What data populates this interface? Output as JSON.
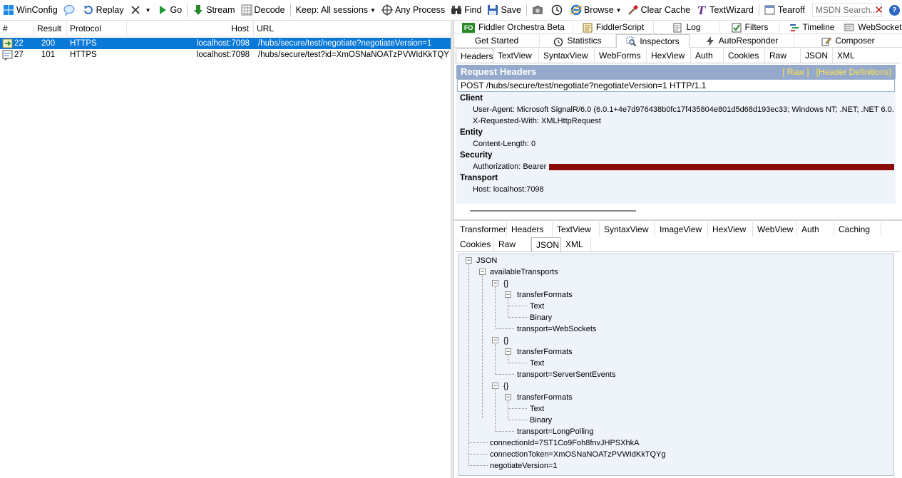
{
  "toolbar": {
    "winconfig": "WinConfig",
    "replay": "Replay",
    "go": "Go",
    "stream": "Stream",
    "decode": "Decode",
    "keep": "Keep: All sessions",
    "any_process": "Any Process",
    "find": "Find",
    "save": "Save",
    "browse": "Browse",
    "clear_cache": "Clear Cache",
    "textwizard": "TextWizard",
    "tearoff": "Tearoff",
    "msdn_placeholder": "MSDN Search...",
    "help": "?",
    "close": "✕"
  },
  "sessions": {
    "columns": [
      "#",
      "Result",
      "Protocol",
      "Host",
      "URL"
    ],
    "rows": [
      {
        "id": "22",
        "result": "200",
        "protocol": "HTTPS",
        "host": "localhost:7098",
        "url": "/hubs/secure/test/negotiate?negotiateVersion=1"
      },
      {
        "id": "27",
        "result": "101",
        "protocol": "HTTPS",
        "host": "localhost:7098",
        "url": "/hubs/secure/test?id=XmOSNaNOATzPVWIdKkTQYg"
      }
    ]
  },
  "top_tabs": {
    "row1": [
      "Fiddler Orchestra Beta",
      "FiddlerScript",
      "Log",
      "Filters",
      "Timeline",
      "WebSocket"
    ],
    "row2": [
      "Get Started",
      "Statistics",
      "Inspectors",
      "AutoResponder",
      "Composer"
    ],
    "fo_badge": "FO"
  },
  "request_tabs": [
    "Headers",
    "TextView",
    "SyntaxView",
    "WebForms",
    "HexView",
    "Auth",
    "Cookies",
    "Raw",
    "JSON",
    "XML"
  ],
  "request": {
    "title": "Request Headers",
    "raw_link": "[ Raw ]",
    "defs_link": "[Header Definitions]",
    "line": "POST /hubs/secure/test/negotiate?negotiateVersion=1 HTTP/1.1",
    "groups": [
      {
        "name": "Client",
        "headers": [
          "User-Agent: Microsoft SignalR/6.0 (6.0.1+4e7d976438b0fc17f435804e801d5d68d193ec33; Windows NT; .NET; .NET 6.0.",
          "X-Requested-With: XMLHttpRequest"
        ]
      },
      {
        "name": "Entity",
        "headers": [
          "Content-Length: 0"
        ]
      },
      {
        "name": "Security",
        "headers": [
          "Authorization: Bearer"
        ]
      },
      {
        "name": "Transport",
        "headers": [
          "Host: localhost:7098"
        ]
      }
    ]
  },
  "response_tabs_row1": [
    "Transformer",
    "Headers",
    "TextView",
    "SyntaxView",
    "ImageView",
    "HexView",
    "WebView",
    "Auth",
    "Caching"
  ],
  "response_tabs_row2": [
    "Cookies",
    "Raw",
    "JSON",
    "XML"
  ],
  "json_tree": {
    "root": "JSON",
    "available": "availableTransports",
    "obj": "{}",
    "transfer_formats": "transferFormats",
    "t1_formats": [
      "Text",
      "Binary"
    ],
    "t1_transport": "transport=WebSockets",
    "t2_formats": [
      "Text"
    ],
    "t2_transport": "transport=ServerSentEvents",
    "t3_formats": [
      "Text",
      "Binary"
    ],
    "t3_transport": "transport=LongPolling",
    "connection_id": "connectionId=7ST1Co9Foh8fnvJHPSXhkA",
    "connection_token": "connectionToken=XmOSNaNOATzPVWIdKkTQYg",
    "negotiate_version": "negotiateVersion=1"
  },
  "colors": {
    "selection": "#0a78d7",
    "header_bar": "#94a9cb",
    "header_links": "#ffe44c",
    "panel_bg": "#eef4fa",
    "redaction": "#8b0a0a"
  }
}
